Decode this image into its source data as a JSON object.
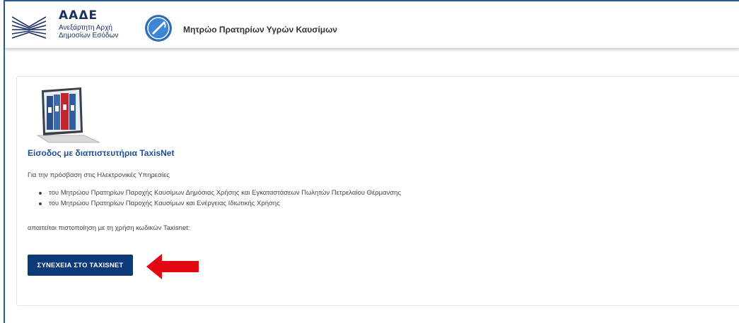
{
  "header": {
    "logo_title": "ΑΑΔΕ",
    "logo_subtitle_line1": "Ανεξάρτητη Αρχή",
    "logo_subtitle_line2": "Δημοσίων Εσόδων",
    "app_title": "Μητρώο Πρατηρίων Υγρών Καυσίμων",
    "icons": {
      "logo": "aade-logo-icon",
      "app": "fuel-pump-icon"
    }
  },
  "main": {
    "illustration": "laptop-binders-illustration",
    "login_title": "Είσοδος με διαπιστευτήρια TaxisNet",
    "intro": "Για την πρόσβαση στις Ηλεκτρονικές Υπηρεσίες",
    "bullets": [
      "του Μητρώου Πρατηρίων Παροχής Καυσίμων Δημόσιας Χρήσης και Εγκαταστάσεων Πωλητών Πετρελαίου Θέρμανσης",
      "του Μητρώου Πρατηρίων Παροχής Καυσίμων και Ενέργειας Ιδιωτικής Χρήσης"
    ],
    "note": "απαιτείται πιστοποίηση με τη χρήση κωδικών Taxisnet:",
    "continue_button": "ΣΥΝΕΧΕΙΑ ΣΤΟ TAXISNET",
    "annotation_arrow": "red-left-arrow-icon"
  },
  "colors": {
    "brand_navy": "#1b2f63",
    "title_blue": "#1f4e96",
    "button_bg": "#0f3a7a",
    "arrow_red": "#e30613"
  }
}
